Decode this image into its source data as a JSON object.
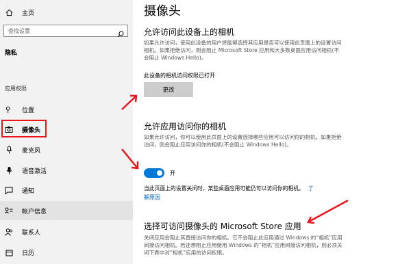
{
  "sidebar": {
    "home_label": "主页",
    "search_placeholder": "查找设置",
    "section_title": "隐私",
    "category_label": "应用权限",
    "items": [
      {
        "label": "位置",
        "icon": "location-icon"
      },
      {
        "label": "摄像头",
        "icon": "camera-icon"
      },
      {
        "label": "麦克风",
        "icon": "microphone-icon"
      },
      {
        "label": "语音激活",
        "icon": "voice-activation-icon"
      },
      {
        "label": "通知",
        "icon": "notification-icon"
      },
      {
        "label": "帐户信息",
        "icon": "account-info-icon"
      },
      {
        "label": "联系人",
        "icon": "contacts-icon"
      },
      {
        "label": "日历",
        "icon": "calendar-icon"
      }
    ]
  },
  "main": {
    "page_title": "摄像头",
    "section1": {
      "heading": "允许访问此设备上的相机",
      "description": "如果允许访问，使用此设备的用户将能够选择其应用是否可以使用此页面上的设置访问相机。如果拒绝访问，则会阻止 Microsoft Store 应用和大多数桌面应用访问相机(不会阻止 Windows Hello)。",
      "status": "此设备的相机访问权限已打开",
      "button_label": "更改"
    },
    "section2": {
      "heading": "允许应用访问你的相机",
      "description": "如果允许访问，你可以使用此页面上的设置选择哪些应用可以访问你的相机。如果拒绝访问，则会阻止应用访问你的相机(不会阻止 Windows Hello)。",
      "toggle_label": "开",
      "toggle_on": true,
      "note": "当此页面上的设置关闭时，某些桌面应用可能仍可以访问你的相机。",
      "note_link_part1": "了",
      "note_link_part2": "解原因"
    },
    "section3": {
      "heading": "选择可访问摄像头的 Microsoft Store 应用",
      "description": "关闭应用会阻止其直接访问你的相机。它不会阻止此应用通过 Windows 的“相机”应用间接访问相机。若还想阻止应用使用 Windows 的“相机”应用间接访问相机，则必须关闭下表中对“相机”应用的访问权限。"
    }
  },
  "colors": {
    "highlight_red": "#e8161b",
    "accent_blue": "#0078d7",
    "sidebar_bg": "#f2f2f2"
  }
}
